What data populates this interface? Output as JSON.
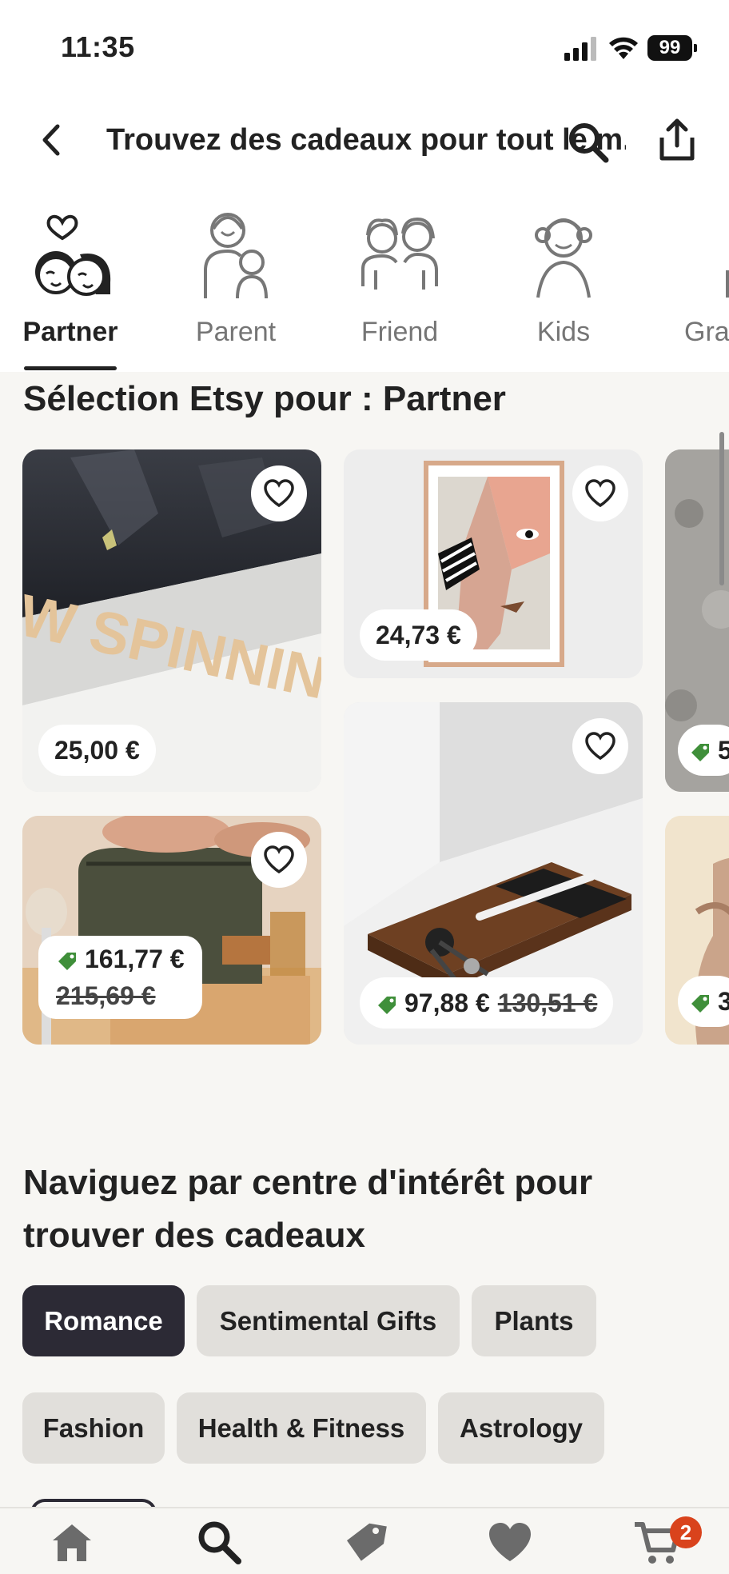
{
  "status_bar": {
    "time": "11:35",
    "battery": "99"
  },
  "header": {
    "title": "Trouvez des cadeaux pour tout le m..."
  },
  "tabs": [
    {
      "label": "Partner",
      "icon": "couple-icon",
      "active": true
    },
    {
      "label": "Parent",
      "icon": "parent-icon",
      "active": false
    },
    {
      "label": "Friend",
      "icon": "friends-icon",
      "active": false
    },
    {
      "label": "Kids",
      "icon": "kid-icon",
      "active": false
    },
    {
      "label": "Gra",
      "icon": "grandparent-icon",
      "active": false
    }
  ],
  "selection": {
    "title": "Sélection Etsy pour : Partner",
    "items": [
      {
        "price": "25,00 €",
        "sale": false,
        "image_text": "W SPINNING"
      },
      {
        "price": "24,73 €",
        "sale": false
      },
      {
        "price": "161,77 €",
        "original_price": "215,69 €",
        "sale": true
      },
      {
        "price": "97,88 €",
        "original_price": "130,51 €",
        "sale": true
      },
      {
        "price": "5",
        "sale": true
      },
      {
        "price": "3",
        "sale": true
      }
    ]
  },
  "browse": {
    "title": "Naviguez par centre d'intérêt pour trouver des cadeaux",
    "chips": [
      "Romance",
      "Sentimental Gifts",
      "Plants",
      "Fashion",
      "Health & Fitness",
      "Astrology"
    ],
    "active_chip": "Romance"
  },
  "bottom_nav": {
    "items": [
      "home-icon",
      "search-icon",
      "deals-tag-icon",
      "favorites-heart-icon",
      "cart-icon"
    ],
    "cart_count": "2"
  },
  "colors": {
    "accent": "#2c2a35",
    "sale_green": "#3f8f3a",
    "badge": "#d9431c",
    "chip_bg": "#e1dfdb"
  }
}
